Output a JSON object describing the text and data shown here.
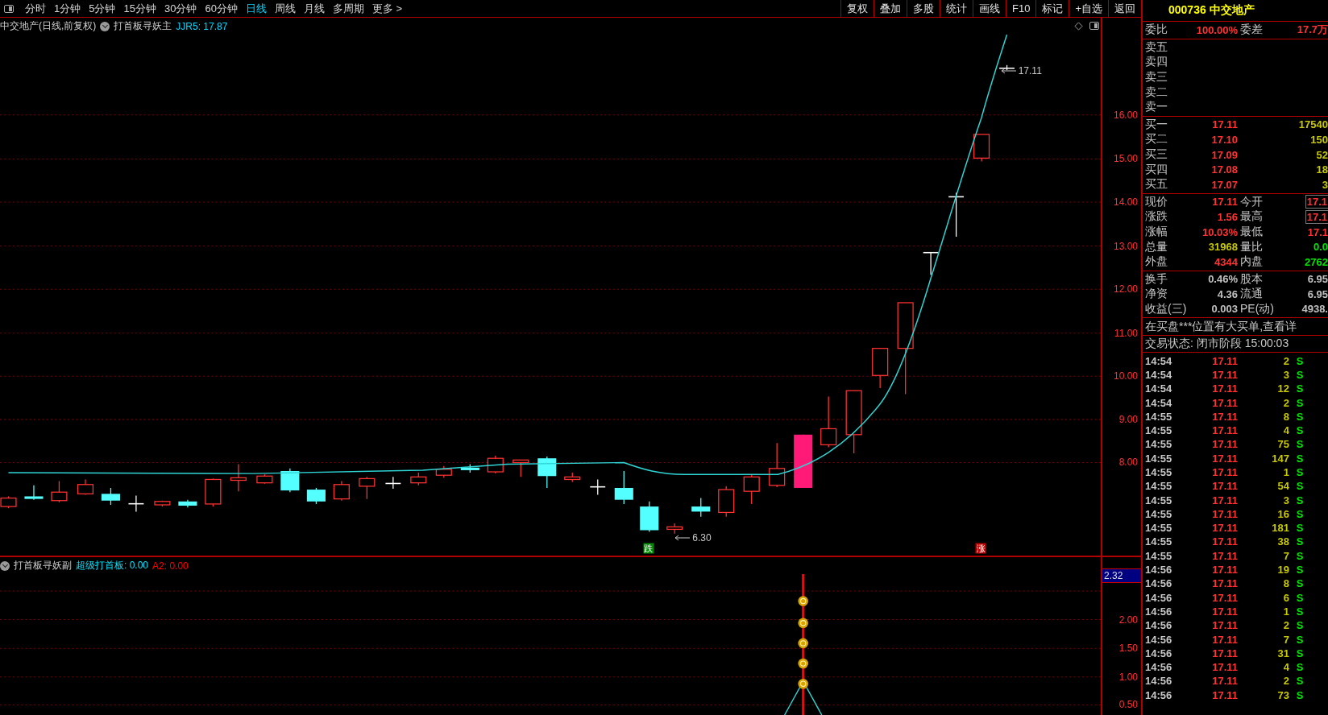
{
  "toolbar": {
    "periods": [
      {
        "label": "分时",
        "selected": false
      },
      {
        "label": "1分钟",
        "selected": false
      },
      {
        "label": "5分钟",
        "selected": false
      },
      {
        "label": "15分钟",
        "selected": false
      },
      {
        "label": "30分钟",
        "selected": false
      },
      {
        "label": "60分钟",
        "selected": false
      },
      {
        "label": "日线",
        "selected": true
      },
      {
        "label": "周线",
        "selected": false
      },
      {
        "label": "月线",
        "selected": false
      },
      {
        "label": "多周期",
        "selected": false
      },
      {
        "label": "更多 >",
        "selected": false
      }
    ],
    "buttons": [
      "复权",
      "叠加",
      "多股",
      "统计",
      "画线",
      "F10",
      "标记",
      "+自选",
      "返回"
    ]
  },
  "chart": {
    "title": "中交地产(日线,前复权)",
    "indicator": "打首板寻妖主",
    "reading": "JJR5: 17.87",
    "price_labels": [
      "16.00",
      "15.00",
      "14.00",
      "13.00",
      "12.00",
      "11.00",
      "10.00",
      "9.00",
      "8.00"
    ],
    "callouts": [
      {
        "text": "17.11",
        "kind": "high"
      },
      {
        "text": "6.30",
        "kind": "low"
      }
    ],
    "signals": [
      {
        "text": "跌",
        "kind": "fall"
      },
      {
        "text": "涨",
        "kind": "rise"
      }
    ]
  },
  "indicator": {
    "name": "打首板寻妖副",
    "readings": [
      {
        "text": "超级打首板: 0.00",
        "color": "#00e5ff"
      },
      {
        "text": "A2: 0.00",
        "color": "#ff0000"
      }
    ],
    "current": "2.32",
    "axis_labels": [
      "2.00",
      "1.50",
      "1.00",
      "0.50"
    ]
  },
  "quote": {
    "code": "000736",
    "name": "中交地产",
    "ratio": {
      "left": {
        "label": "委比",
        "value": "100.00%",
        "kind": "up"
      },
      "right": {
        "label": "委差",
        "value": "17.7万",
        "kind": "up"
      }
    },
    "sell": [
      {
        "label": "卖五"
      },
      {
        "label": "卖四"
      },
      {
        "label": "卖三"
      },
      {
        "label": "卖二"
      },
      {
        "label": "卖一"
      }
    ],
    "buy": [
      {
        "label": "买一",
        "price": "17.11",
        "volume": "17540"
      },
      {
        "label": "买二",
        "price": "17.10",
        "volume": "150"
      },
      {
        "label": "买三",
        "price": "17.09",
        "volume": "52"
      },
      {
        "label": "买四",
        "price": "17.08",
        "volume": "18"
      },
      {
        "label": "买五",
        "price": "17.07",
        "volume": "3"
      }
    ],
    "stats": [
      {
        "left": {
          "label": "现价",
          "value": "17.11",
          "kind": "up"
        },
        "right": {
          "label": "今开",
          "value": "17.1",
          "kind": "up",
          "boxed": true
        }
      },
      {
        "left": {
          "label": "涨跌",
          "value": "1.56",
          "kind": "up"
        },
        "right": {
          "label": "最高",
          "value": "17.1",
          "kind": "up",
          "boxed": true
        }
      },
      {
        "left": {
          "label": "涨幅",
          "value": "10.03%",
          "kind": "up"
        },
        "right": {
          "label": "最低",
          "value": "17.1",
          "kind": "up",
          "boxed": false
        }
      },
      {
        "left": {
          "label": "总量",
          "value": "31968",
          "kind": "vol"
        },
        "right": {
          "label": "量比",
          "value": "0.0",
          "kind": "down",
          "boxed": false
        }
      },
      {
        "left": {
          "label": "外盘",
          "value": "4344",
          "kind": "up"
        },
        "right": {
          "label": "内盘",
          "value": "2762",
          "kind": "down",
          "boxed": false
        }
      }
    ],
    "info": [
      {
        "left": {
          "label": "换手",
          "value": "0.46%",
          "kind": "plain"
        },
        "right": {
          "label": "股本",
          "value": "6.95",
          "kind": "plain"
        }
      },
      {
        "left": {
          "label": "净资",
          "value": "4.36",
          "kind": "plain"
        },
        "right": {
          "label": "流通",
          "value": "6.95",
          "kind": "plain"
        }
      },
      {
        "left": {
          "label": "收益(三)",
          "value": "0.003",
          "kind": "plain"
        },
        "right": {
          "label": "PE(动)",
          "value": "4938.",
          "kind": "plain"
        }
      }
    ],
    "notice": "在买盘***位置有大买单,查看详",
    "status": "交易状态: 闭市阶段 15:00:03",
    "trades": [
      {
        "time": "14:54",
        "price": "17.11",
        "volume": "2",
        "side": "S"
      },
      {
        "time": "14:54",
        "price": "17.11",
        "volume": "3",
        "side": "S"
      },
      {
        "time": "14:54",
        "price": "17.11",
        "volume": "12",
        "side": "S"
      },
      {
        "time": "14:54",
        "price": "17.11",
        "volume": "2",
        "side": "S"
      },
      {
        "time": "14:55",
        "price": "17.11",
        "volume": "8",
        "side": "S"
      },
      {
        "time": "14:55",
        "price": "17.11",
        "volume": "4",
        "side": "S"
      },
      {
        "time": "14:55",
        "price": "17.11",
        "volume": "75",
        "side": "S"
      },
      {
        "time": "14:55",
        "price": "17.11",
        "volume": "147",
        "side": "S"
      },
      {
        "time": "14:55",
        "price": "17.11",
        "volume": "1",
        "side": "S"
      },
      {
        "time": "14:55",
        "price": "17.11",
        "volume": "54",
        "side": "S"
      },
      {
        "time": "14:55",
        "price": "17.11",
        "volume": "3",
        "side": "S"
      },
      {
        "time": "14:55",
        "price": "17.11",
        "volume": "16",
        "side": "S"
      },
      {
        "time": "14:55",
        "price": "17.11",
        "volume": "181",
        "side": "S"
      },
      {
        "time": "14:55",
        "price": "17.11",
        "volume": "38",
        "side": "S"
      },
      {
        "time": "14:55",
        "price": "17.11",
        "volume": "7",
        "side": "S"
      },
      {
        "time": "14:56",
        "price": "17.11",
        "volume": "19",
        "side": "S"
      },
      {
        "time": "14:56",
        "price": "17.11",
        "volume": "8",
        "side": "S"
      },
      {
        "time": "14:56",
        "price": "17.11",
        "volume": "6",
        "side": "S"
      },
      {
        "time": "14:56",
        "price": "17.11",
        "volume": "1",
        "side": "S"
      },
      {
        "time": "14:56",
        "price": "17.11",
        "volume": "2",
        "side": "S"
      },
      {
        "time": "14:56",
        "price": "17.11",
        "volume": "7",
        "side": "S"
      },
      {
        "time": "14:56",
        "price": "17.11",
        "volume": "31",
        "side": "S"
      },
      {
        "time": "14:56",
        "price": "17.11",
        "volume": "4",
        "side": "S"
      },
      {
        "time": "14:56",
        "price": "17.11",
        "volume": "2",
        "side": "S"
      },
      {
        "time": "14:56",
        "price": "17.11",
        "volume": "73",
        "side": "S"
      }
    ]
  }
}
